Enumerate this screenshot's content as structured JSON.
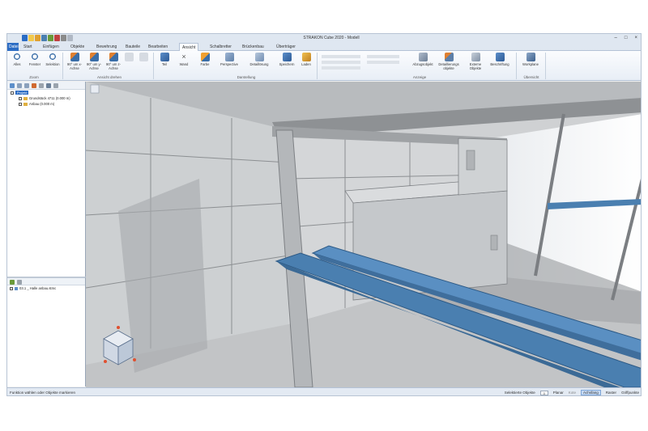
{
  "window": {
    "title": "STRAKON Cube 2020 - Modell",
    "buttons": [
      "–",
      "□",
      "×"
    ]
  },
  "tabs": [
    {
      "label": "Datei",
      "file": true
    },
    {
      "label": "Start"
    },
    {
      "label": "Einfügen"
    },
    {
      "label": "Objekte"
    },
    {
      "label": "Bewehrung"
    },
    {
      "label": "Bauteile"
    },
    {
      "label": "Bearbeiten"
    },
    {
      "label": "Ansicht",
      "active": true
    },
    {
      "label": "Schalbretter"
    },
    {
      "label": "Brückenbau"
    },
    {
      "label": "Überträger"
    }
  ],
  "ribbon": {
    "zoom_buttons": [
      {
        "label": "Alles",
        "icon": "zoom-all-icon"
      },
      {
        "label": "Fenster",
        "icon": "zoom-window-icon"
      },
      {
        "label": "Selektion",
        "icon": "zoom-selection-icon"
      }
    ],
    "rotate_buttons": [
      {
        "label": "90° um x-Achse",
        "icon": "rotate-x-icon"
      },
      {
        "label": "90° um y-Achse",
        "icon": "rotate-y-icon"
      },
      {
        "label": "90° um z-Achse",
        "icon": "rotate-z-icon"
      }
    ],
    "view_buttons": [
      {
        "label": "Teil",
        "icon": "cube-part-icon"
      },
      {
        "label": "Wand",
        "icon": "wall-icon"
      },
      {
        "label": "Farbe",
        "icon": "color-icon"
      },
      {
        "label": "Perspective",
        "icon": "perspective-icon"
      },
      {
        "label": "Detaillösung",
        "icon": "detail-icon"
      },
      {
        "label": "Speichern",
        "icon": "save-view-icon"
      },
      {
        "label": "Laden",
        "icon": "load-view-icon"
      }
    ],
    "display_buttons": [
      {
        "label": "Abzugsobjekt",
        "icon": "deduction-object-icon"
      },
      {
        "label": "Detaillierungs objekte",
        "icon": "detailing-objects-icon"
      },
      {
        "label": "Externe Objekte",
        "icon": "external-objects-icon"
      },
      {
        "label": "Beschriftung",
        "icon": "labeling-icon"
      }
    ],
    "workplane_button": {
      "label": "Workplane",
      "icon": "workplane-icon"
    },
    "groups": {
      "zoom": "Zoom",
      "rotate": "Ansicht drehen",
      "display": "Darstellung",
      "show": "Anzeige",
      "overview": "Übersicht"
    }
  },
  "left_panel": {
    "tree": [
      {
        "label": "Projekt",
        "tag": true
      },
      {
        "label": "Grundstück 4711 (0.000 m)"
      },
      {
        "label": "Anbau (0.000 m)"
      }
    ],
    "files": [
      {
        "label": "03.1 _ Halle anbau.stmc"
      }
    ]
  },
  "status": {
    "message": "Funktion wählen oder Objekte markieren",
    "selected_label": "Selektierte Objekte",
    "selected_count": "0",
    "items": [
      {
        "label": "Planar",
        "state": "normal"
      },
      {
        "label": "Kote",
        "state": "off"
      },
      {
        "label": "Achsfang",
        "state": "on"
      },
      {
        "label": "Raster",
        "state": "normal"
      },
      {
        "label": "Griffpunkte",
        "state": "normal"
      }
    ]
  },
  "colors": {
    "accent": "#2b6cc4",
    "steel_beam": "#4a7fb0",
    "concrete": "#c9cbcd"
  }
}
